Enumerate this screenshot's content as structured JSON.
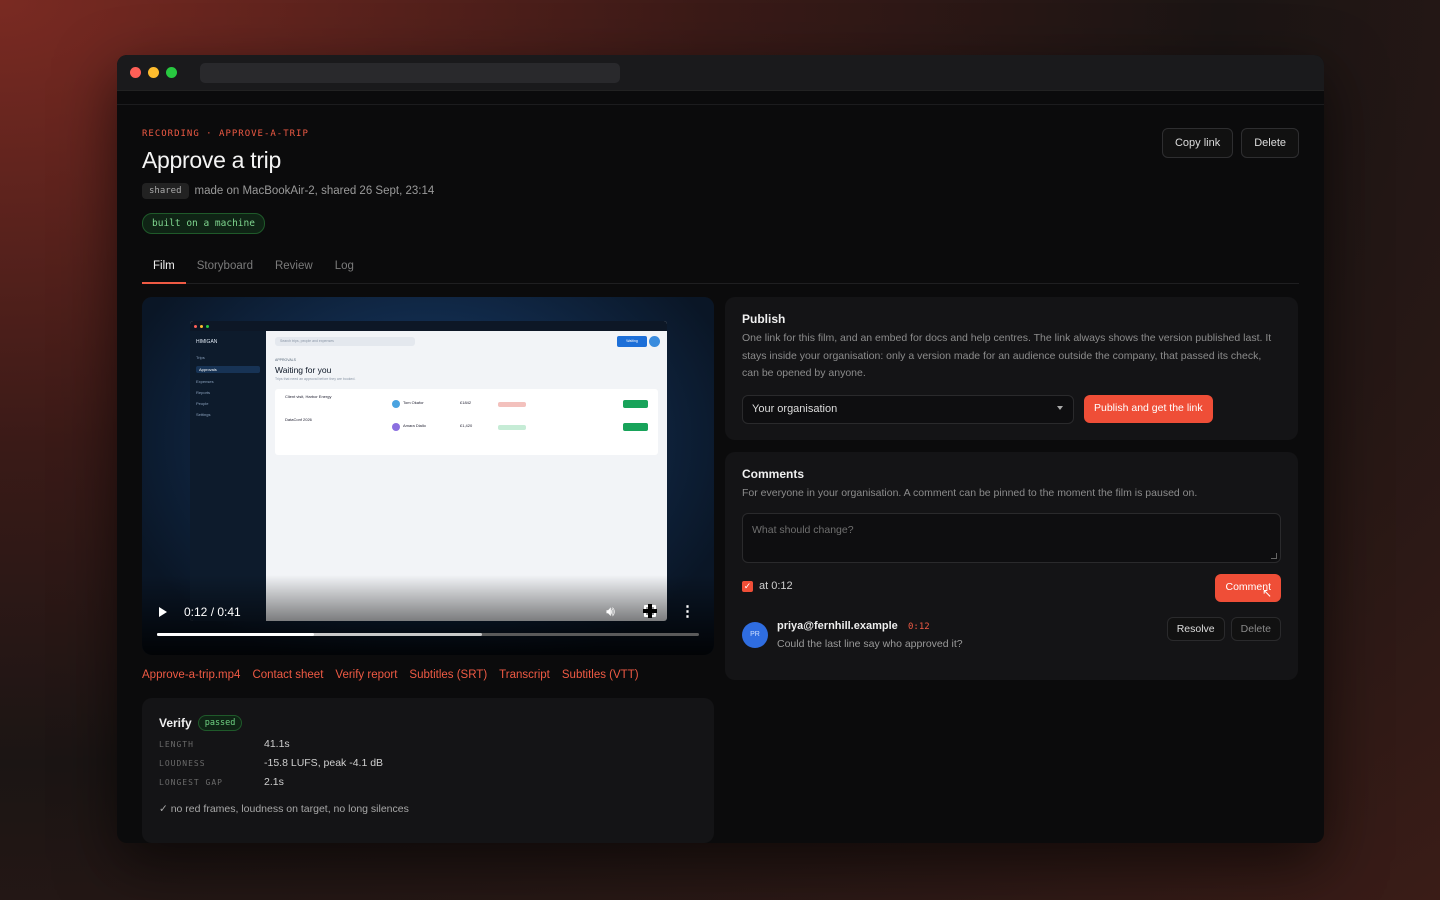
{
  "window": {
    "traffic_lights": {
      "close": "#ff5f57",
      "minimize": "#febc2e",
      "zoom": "#28c840"
    },
    "accent": "#ef4e37"
  },
  "header": {
    "breadcrumb": "RECORDING · APPROVE-A-TRIP",
    "title": "Approve a trip",
    "shared_badge": "shared",
    "meta": "made on MacBookAir-2, shared 26 Sept, 23:14",
    "built_badge": "built on a machine",
    "copy_link": "Copy link",
    "delete": "Delete"
  },
  "tabs": [
    {
      "label": "Film",
      "active": true
    },
    {
      "label": "Storyboard",
      "active": false
    },
    {
      "label": "Review",
      "active": false
    },
    {
      "label": "Log",
      "active": false
    }
  ],
  "video": {
    "time": "0:12 / 0:41",
    "played_fraction": 0.29,
    "buffered_fraction": 0.6,
    "preview": {
      "brand": "HIMIGAN",
      "sidebar": [
        "Trips",
        "Approvals",
        "Expenses",
        "Reports",
        "People",
        "Settings"
      ],
      "search_placeholder": "Search trips, people and expenses",
      "waiting_button": "Waiting",
      "kicker": "APPROVALS",
      "heading": "Waiting for you",
      "subheading": "Trips that need an approval before they are booked.",
      "rows": [
        {
          "name": "Client visit, Harbor Energy",
          "person": "Tom Okafor",
          "cost": "£1842",
          "status": "Over budget",
          "status_color": "#f3c1bd"
        },
        {
          "name": "DataConf 2026",
          "person": "Amara Diallo",
          "cost": "£1,420",
          "status": "Within policy",
          "status_color": "#c6ecd6"
        }
      ]
    }
  },
  "files": [
    "Approve-a-trip.mp4",
    "Contact sheet",
    "Verify report",
    "Subtitles (SRT)",
    "Transcript",
    "Subtitles (VTT)"
  ],
  "verify": {
    "title": "Verify",
    "status": "passed",
    "rows": [
      {
        "key": "LENGTH",
        "value": "41.1s"
      },
      {
        "key": "LOUDNESS",
        "value": "-15.8 LUFS, peak -4.1 dB"
      },
      {
        "key": "LONGEST GAP",
        "value": "2.1s"
      }
    ],
    "summary": "✓ no red frames, loudness on target, no long silences"
  },
  "publish": {
    "title": "Publish",
    "description": "One link for this film, and an embed for docs and help centres. The link always shows the version published last. It stays inside your organisation: only a version made for an audience outside the company, that passed its check, can be opened by anyone.",
    "audience": "Your organisation",
    "button": "Publish and get the link"
  },
  "comments": {
    "title": "Comments",
    "description": "For everyone in your organisation. A comment can be pinned to the moment the film is paused on.",
    "placeholder": "What should change?",
    "pin_label": "at 0:12",
    "pin_checked": true,
    "button": "Comment",
    "items": [
      {
        "initials": "PR",
        "author": "priya@fernhill.example",
        "time": "0:12",
        "text": "Could the last line say who approved it?",
        "resolve": "Resolve",
        "delete": "Delete"
      }
    ]
  }
}
